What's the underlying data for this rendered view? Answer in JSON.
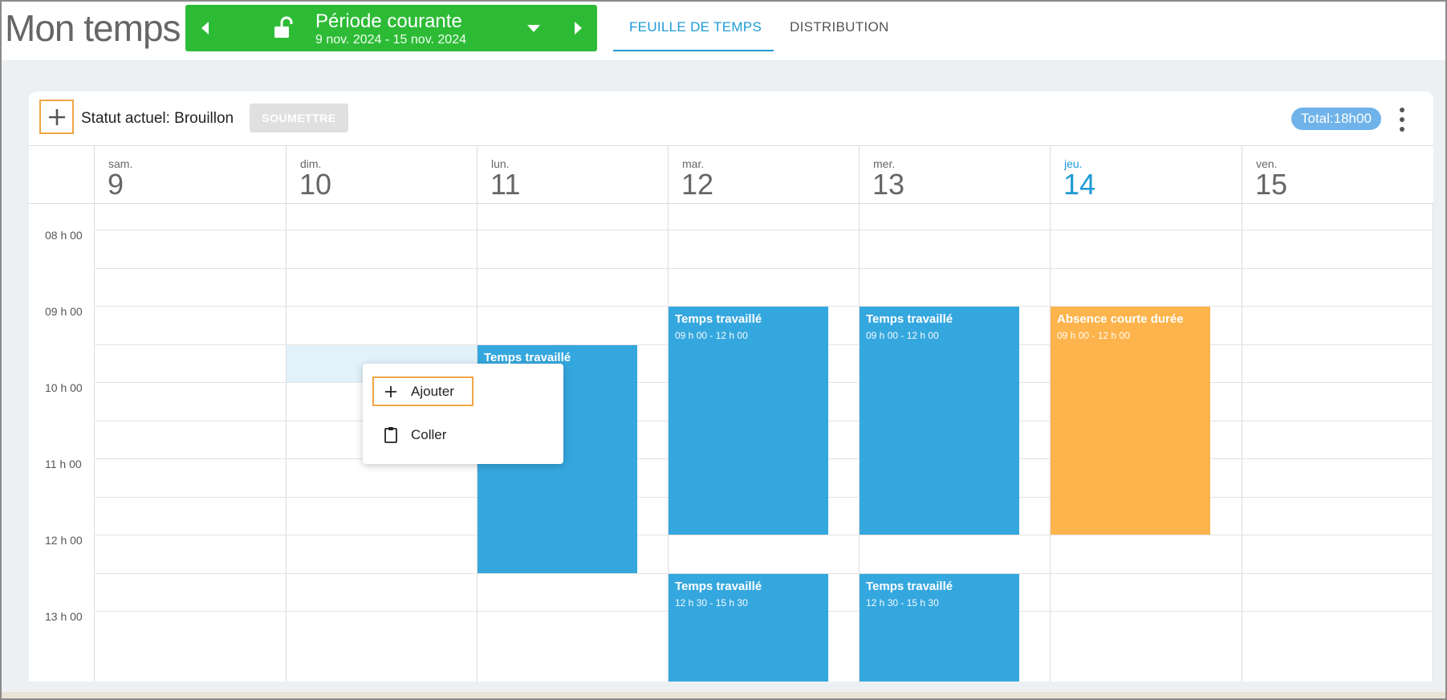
{
  "app": {
    "title": "Mon temps"
  },
  "period": {
    "title": "Période courante",
    "range": "9 nov. 2024 - 15 nov. 2024",
    "prev_icon": "chevron-left-icon",
    "next_icon": "chevron-right-icon",
    "lock_icon": "unlock-icon",
    "dropdown_icon": "caret-down-icon",
    "color": "#2dbb36"
  },
  "tabs": [
    {
      "label": "FEUILLE DE TEMPS",
      "active": true
    },
    {
      "label": "DISTRIBUTION",
      "active": false
    }
  ],
  "toolbar": {
    "status": "Statut actuel: Brouillon",
    "submit_label": "SOUMETTRE",
    "total": "Total:18h00"
  },
  "days": [
    {
      "name": "sam.",
      "num": "9",
      "today": false
    },
    {
      "name": "dim.",
      "num": "10",
      "today": false
    },
    {
      "name": "lun.",
      "num": "11",
      "today": false
    },
    {
      "name": "mar.",
      "num": "12",
      "today": false
    },
    {
      "name": "mer.",
      "num": "13",
      "today": false
    },
    {
      "name": "jeu.",
      "num": "14",
      "today": true
    },
    {
      "name": "ven.",
      "num": "15",
      "today": false
    }
  ],
  "hours": [
    "08 h 00",
    "09 h 00",
    "10 h 00",
    "11 h 00",
    "12 h 00",
    "13 h 00"
  ],
  "events": {
    "mon": {
      "title": "Temps travaillé",
      "time": ""
    },
    "tue_am": {
      "title": "Temps travaillé",
      "time": "09 h 00 - 12 h 00"
    },
    "wed_am": {
      "title": "Temps travaillé",
      "time": "09 h 00 - 12 h 00"
    },
    "thu_am": {
      "title": "Absence courte durée",
      "time": "09 h 00 - 12 h 00"
    },
    "tue_pm": {
      "title": "Temps travaillé",
      "time": "12 h 30 - 15 h 30"
    },
    "wed_pm": {
      "title": "Temps travaillé",
      "time": "12 h 30 - 15 h 30"
    }
  },
  "context_menu": {
    "add_label": "Ajouter",
    "paste_label": "Coller"
  },
  "colors": {
    "accent": "#1e9ad6",
    "work": "#35a7df",
    "absence": "#fdb44c",
    "focus": "#f1a545"
  }
}
